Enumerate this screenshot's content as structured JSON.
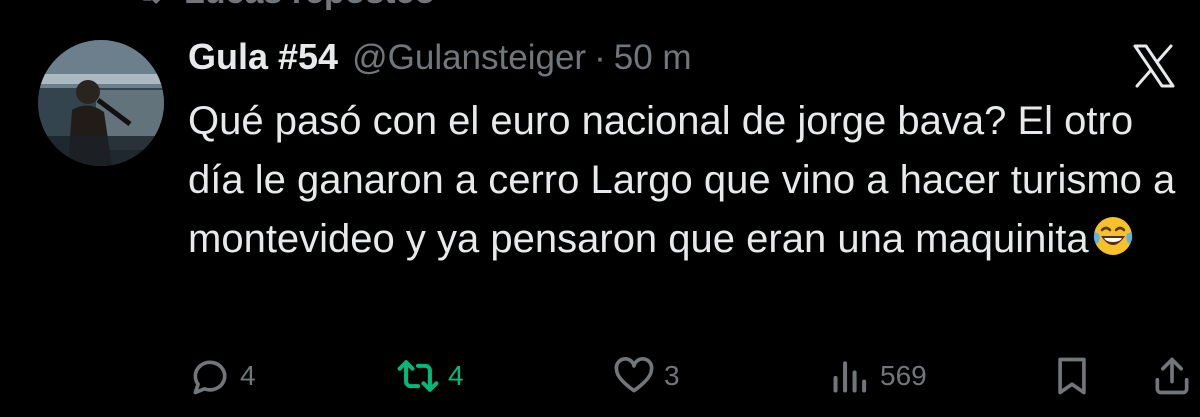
{
  "repost_banner": {
    "label": "Lucas reposteó"
  },
  "tweet": {
    "author_name": "Gula #54",
    "handle": "@Gulansteiger",
    "separator": "·",
    "time": "50 m",
    "text": "Qué pasó con el euro nacional de jorge  bava? El otro día le ganaron a cerro Largo que vino a hacer turismo a montevideo y ya pensaron que eran una maquinita",
    "emoji": "laughing-with-tears-emoji"
  },
  "actions": {
    "replies": "4",
    "reposts": "4",
    "likes": "3",
    "views": "569"
  },
  "colors": {
    "background": "#000000",
    "text": "#e7e9ea",
    "muted": "#71767b",
    "repost_active": "#00ba7c"
  }
}
